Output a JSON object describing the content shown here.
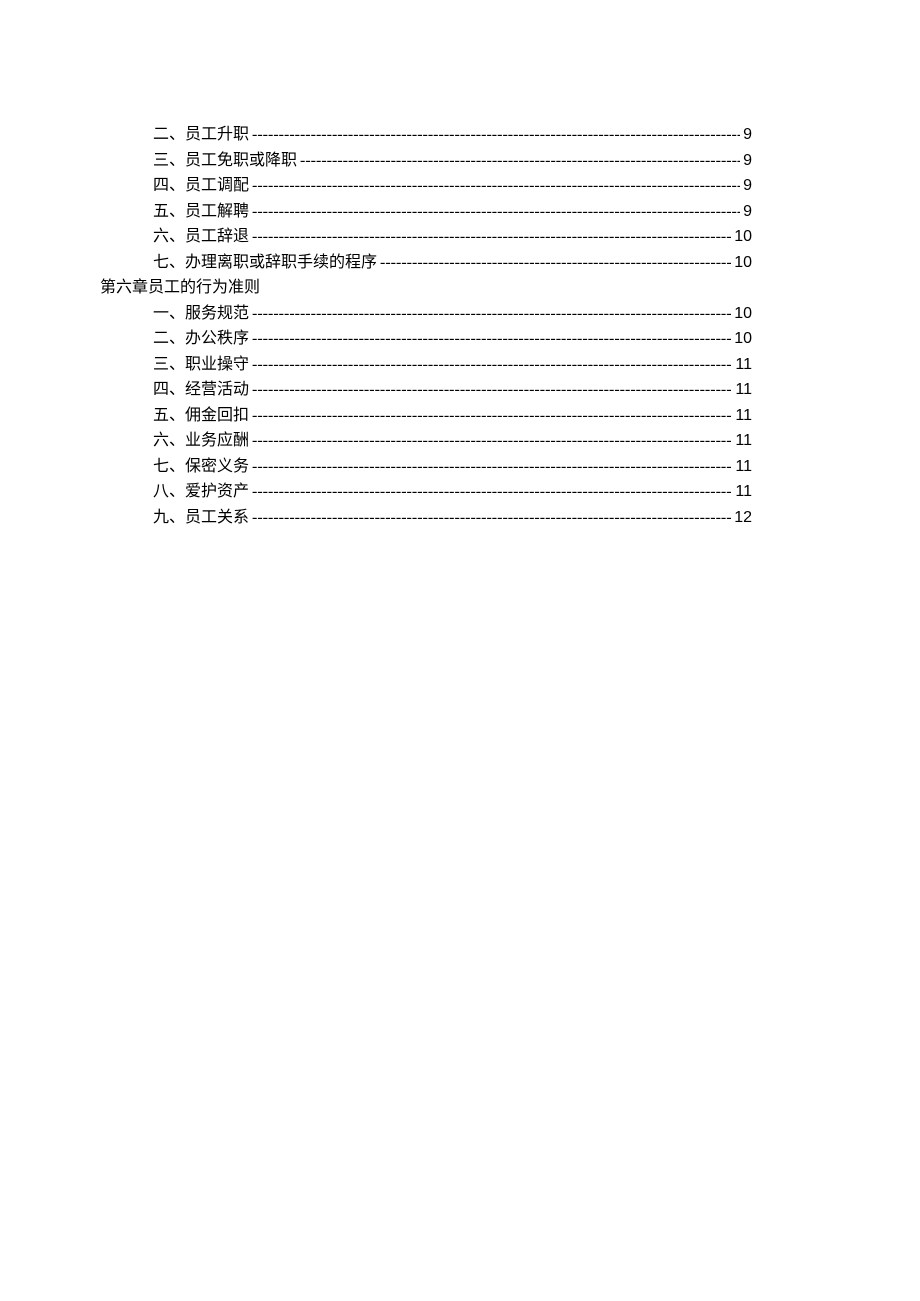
{
  "toc": {
    "section5_items": [
      {
        "label": "二、员工升职",
        "page": "9"
      },
      {
        "label": "三、员工免职或降职",
        "page": "9"
      },
      {
        "label": "四、员工调配",
        "page": "9"
      },
      {
        "label": "五、员工解聘",
        "page": "9"
      },
      {
        "label": "六、员工辞退",
        "page": "10"
      },
      {
        "label": "七、办理离职或辞职手续的程序",
        "page": "10"
      }
    ],
    "section6_heading": "第六章员工的行为准则",
    "section6_items": [
      {
        "label": "一、服务规范",
        "page": "10"
      },
      {
        "label": "二、办公秩序",
        "page": "10"
      },
      {
        "label": "三、职业操守",
        "page": "11"
      },
      {
        "label": "四、经营活动",
        "page": "11"
      },
      {
        "label": "五、佣金回扣",
        "page": "11"
      },
      {
        "label": "六、业务应酬",
        "page": "11"
      },
      {
        "label": "七、保密义务",
        "page": "11"
      },
      {
        "label": "八、爱护资产",
        "page": "11"
      },
      {
        "label": "九、员工关系",
        "page": "12"
      }
    ]
  }
}
